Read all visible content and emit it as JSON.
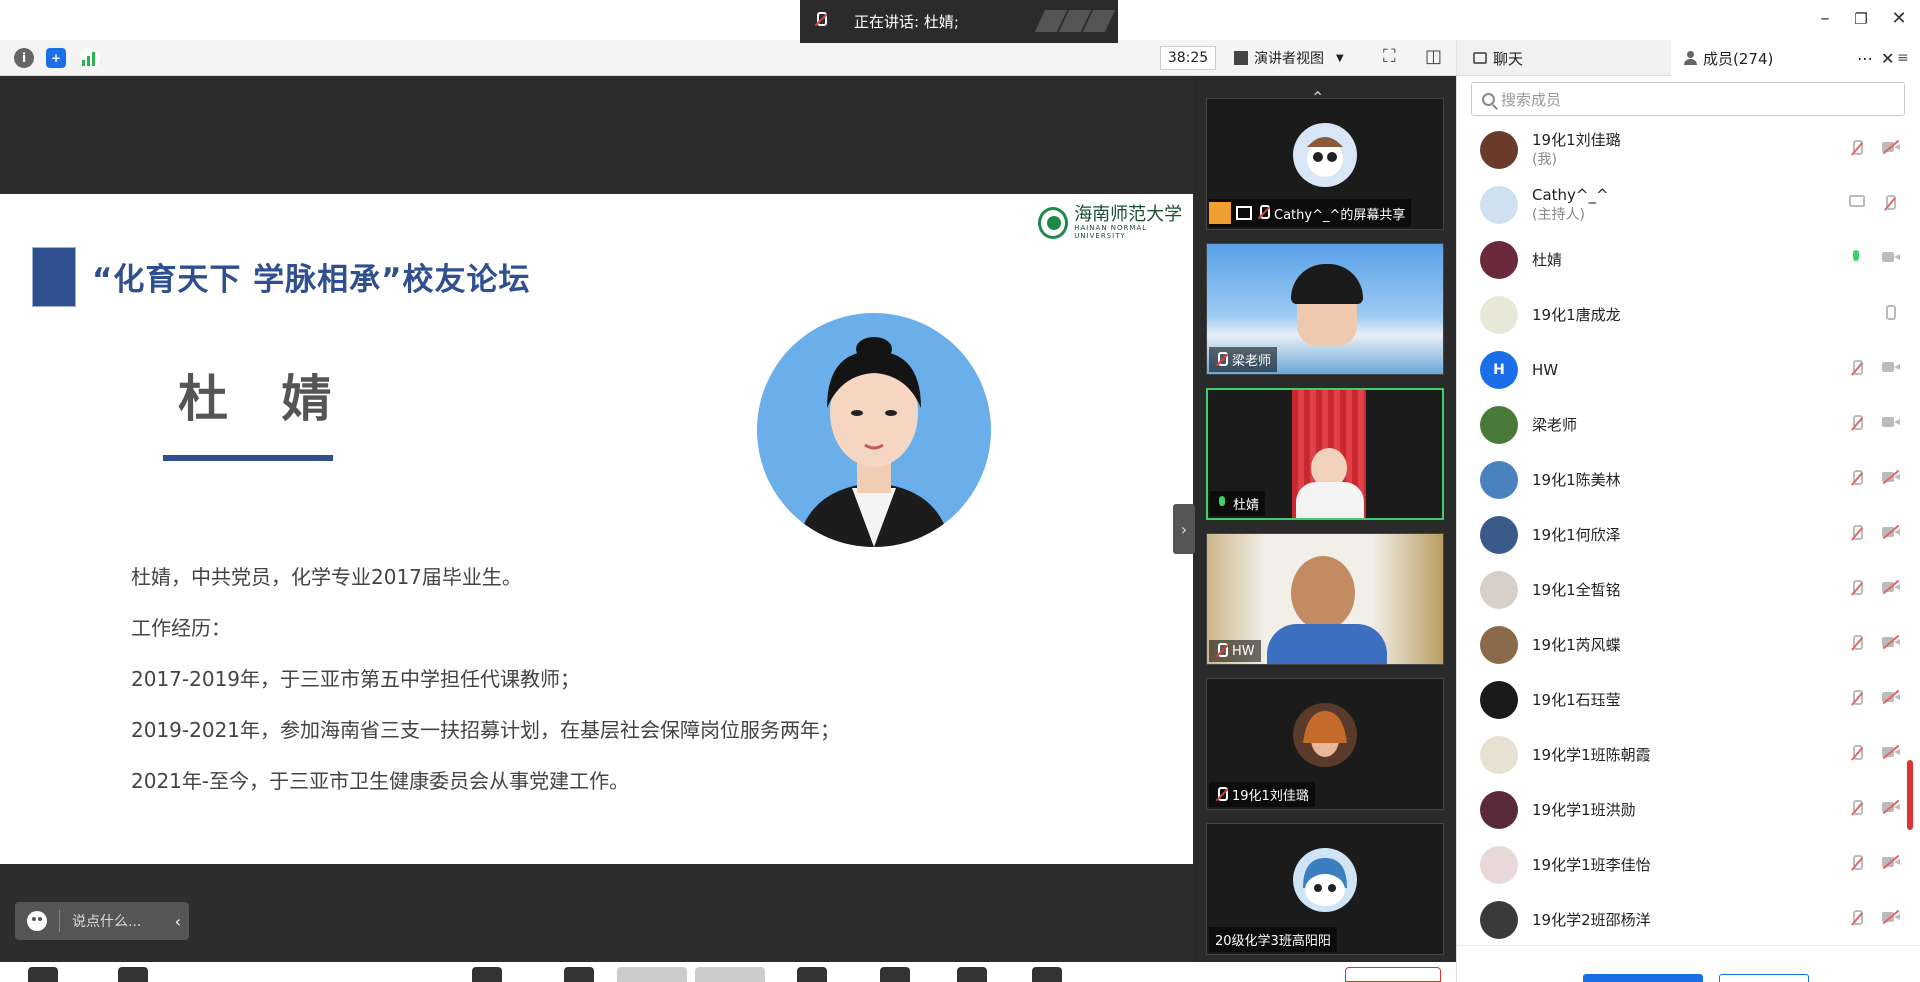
{
  "app": {
    "speaking_label": "正在讲话: 杜婧;",
    "timer": "38:25",
    "view_mode": "演讲者视图"
  },
  "colors": {
    "accent_blue": "#2f4f91",
    "active_green": "#3fcf6f",
    "muted_red": "#e06767",
    "hw_avatar": "#1a6ee8"
  },
  "slide": {
    "logo_cn": "海南师范大学",
    "logo_en": "HAINAN NORMAL UNIVERSITY",
    "title": "“化育天下 学脉相承”校友论坛",
    "name": "杜 婧",
    "bio": [
      "杜婧，中共党员，化学专业2017届毕业生。",
      "工作经历：",
      "2017-2019年，于三亚市第五中学担任代课教师；",
      "2019-2021年，参加海南省三支一扶招募计划，在基层社会保障岗位服务两年；",
      "2021年-至今，于三亚市卫生健康委员会从事党建工作。"
    ]
  },
  "chat_input": {
    "placeholder": "说点什么..."
  },
  "video_tiles": [
    {
      "label": "Cathy^_^的屏幕共享"
    },
    {
      "label": "梁老师"
    },
    {
      "label": "杜婧"
    },
    {
      "label": "HW"
    },
    {
      "label": "19化1刘佳璐"
    },
    {
      "label": "20级化学3班高阳阳"
    }
  ],
  "panel": {
    "chat_tab": "聊天",
    "members_tab": "成员(274)",
    "search_placeholder": "搜索成员",
    "members": [
      {
        "name": "19化1刘佳璐",
        "sub": "(我)"
      },
      {
        "name": "Cathy^_^",
        "sub": "(主持人)"
      },
      {
        "name": "杜婧",
        "sub": ""
      },
      {
        "name": "19化1唐成龙",
        "sub": ""
      },
      {
        "name": "HW",
        "sub": "",
        "initial": "H"
      },
      {
        "name": "梁老师",
        "sub": ""
      },
      {
        "name": "19化1陈美林",
        "sub": ""
      },
      {
        "name": "19化1何欣泽",
        "sub": ""
      },
      {
        "name": "19化1全皙铭",
        "sub": ""
      },
      {
        "name": "19化1芮风蝶",
        "sub": ""
      },
      {
        "name": "19化1石珏莹",
        "sub": ""
      },
      {
        "name": "19化学1班陈朝霞",
        "sub": ""
      },
      {
        "name": "19化学1班洪勋",
        "sub": ""
      },
      {
        "name": "19化学1班李佳怡",
        "sub": ""
      },
      {
        "name": "19化学2班邵杨洋",
        "sub": ""
      }
    ]
  }
}
